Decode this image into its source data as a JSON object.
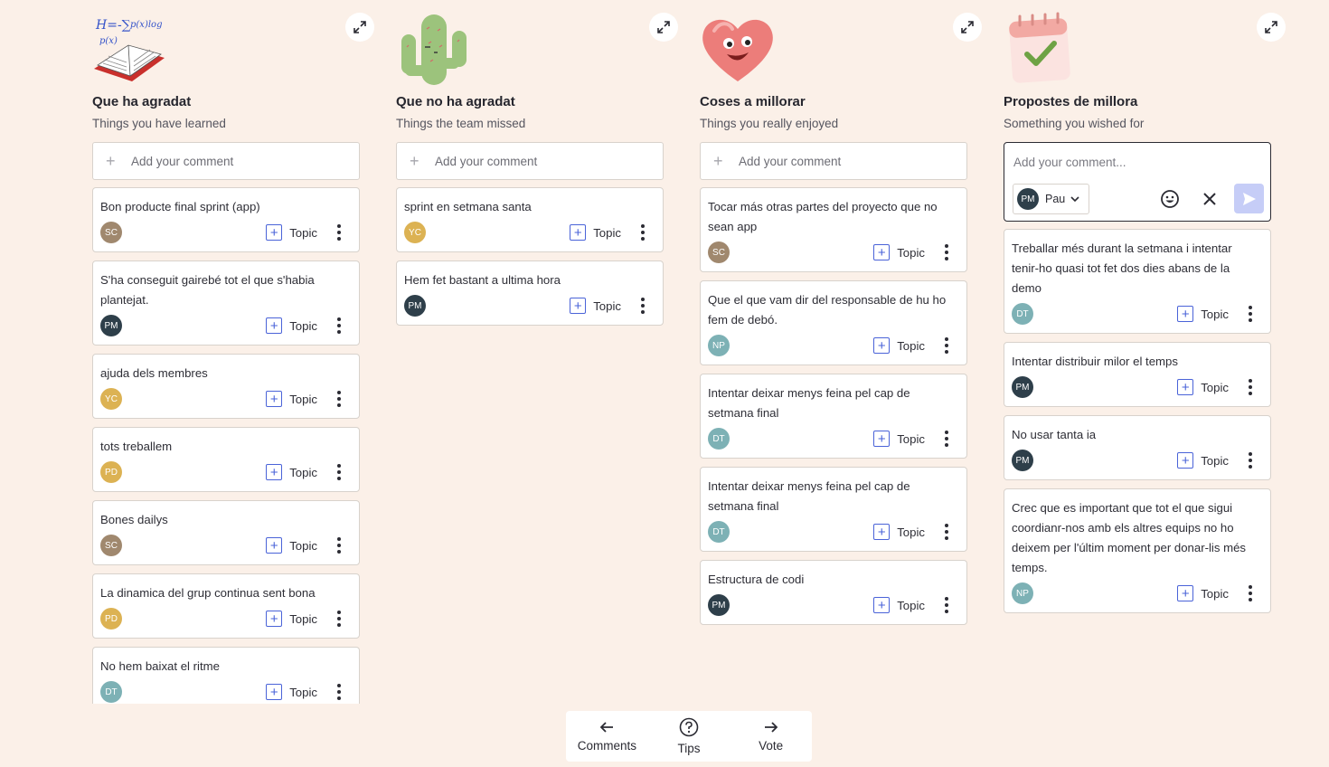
{
  "topic_label": "Topic",
  "add_comment_label": "Add your comment",
  "avatar_colors": {
    "SC": "#a0886e",
    "PM": "#2e3f4a",
    "YC": "#dcb253",
    "PD": "#dcb253",
    "DT": "#7db1b5",
    "NP": "#7db1b5"
  },
  "columns": [
    {
      "title": "Que ha agradat",
      "subtitle": "Things you have learned",
      "illustration": "book-formula-icon",
      "cards": [
        {
          "text": "Bon producte final sprint (app)",
          "author": "SC"
        },
        {
          "text": "S'ha conseguit gairebé tot el que s'habia plantejat.",
          "author": "PM"
        },
        {
          "text": "ajuda dels membres",
          "author": "YC"
        },
        {
          "text": "tots treballem",
          "author": "PD"
        },
        {
          "text": "Bones dailys",
          "author": "SC"
        },
        {
          "text": "La dinamica del grup continua sent bona",
          "author": "PD"
        },
        {
          "text": "No hem baixat el ritme",
          "author": "DT"
        }
      ]
    },
    {
      "title": "Que no ha agradat",
      "subtitle": "Things the team missed",
      "illustration": "cactus-icon",
      "cards": [
        {
          "text": "sprint en setmana santa",
          "author": "YC"
        },
        {
          "text": "Hem fet bastant a ultima hora",
          "author": "PM"
        }
      ]
    },
    {
      "title": "Coses a millorar",
      "subtitle": "Things you really enjoyed",
      "illustration": "heart-face-icon",
      "cards": [
        {
          "text": "Tocar más otras partes del proyecto que no sean app",
          "author": "SC"
        },
        {
          "text": "Que el que vam dir del responsable de hu ho fem de debó.",
          "author": "NP"
        },
        {
          "text": "Intentar deixar menys feina pel cap de setmana final",
          "author": "DT"
        },
        {
          "text": "Intentar deixar menys feina pel cap de setmana final",
          "author": "DT"
        },
        {
          "text": "Estructura de codi",
          "author": "PM"
        }
      ]
    },
    {
      "title": "Propostes de millora",
      "subtitle": "Something you wished for",
      "illustration": "calendar-check-icon",
      "composer": {
        "placeholder": "Add your comment...",
        "author_initials": "PM",
        "author_name": "Pau"
      },
      "cards": [
        {
          "text": "Treballar més durant la setmana i intentar tenir-ho quasi tot fet dos dies abans de la demo",
          "author": "DT"
        },
        {
          "text": "Intentar distribuir milor el temps",
          "author": "PM"
        },
        {
          "text": "No usar tanta ia",
          "author": "PM"
        },
        {
          "text": "Crec que es important que tot el que sigui coordianr-nos amb els altres equips no ho deixem per l'últim moment per donar-lis més temps.",
          "author": "NP"
        }
      ]
    }
  ],
  "bottom_bar": {
    "comments_label": "Comments",
    "tips_label": "Tips",
    "vote_label": "Vote"
  }
}
